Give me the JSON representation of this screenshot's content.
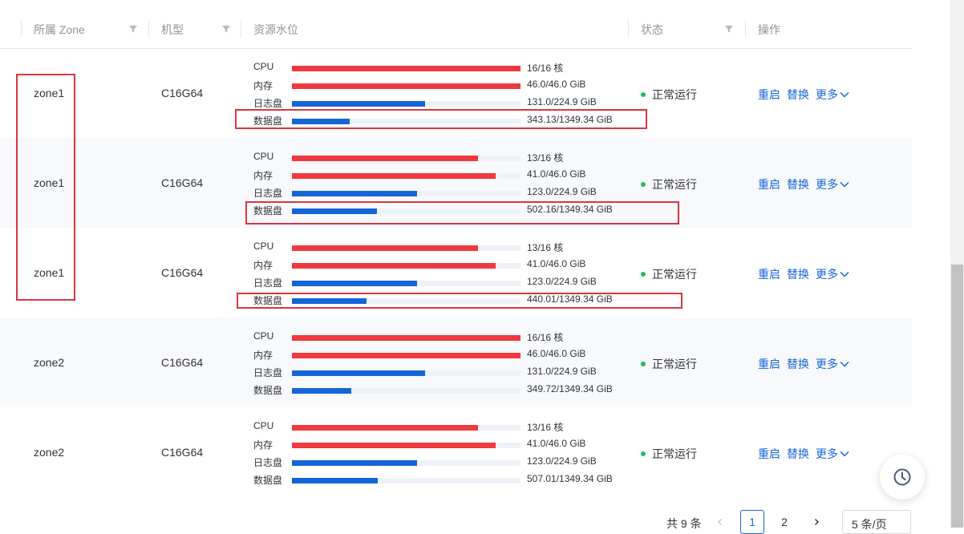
{
  "columns": {
    "zone": "所属 Zone",
    "model": "机型",
    "resource": "资源水位",
    "status": "状态",
    "actions": "操作"
  },
  "colors": {
    "cpu_mem_bar": "#f0393f",
    "disk_bar": "#1565d8",
    "bar_track": "#eef2f8",
    "highlight_box": "#d9363e",
    "link": "#1565d8",
    "status_dot": "#22b868"
  },
  "rows": [
    {
      "zone": "zone1",
      "model": "C16G64",
      "status": "正常运行",
      "resources": [
        {
          "label": "CPU",
          "value": "16/16 核",
          "fill": 1.0
        },
        {
          "label": "内存",
          "value": "46.0/46.0 GiB",
          "fill": 1.0
        },
        {
          "label": "日志盘",
          "value": "131.0/224.9 GiB",
          "fill": 0.582
        },
        {
          "label": "数据盘",
          "value": "343.13/1349.34 GiB",
          "fill": 0.254
        }
      ]
    },
    {
      "zone": "zone1",
      "model": "C16G64",
      "status": "正常运行",
      "resources": [
        {
          "label": "CPU",
          "value": "13/16 核",
          "fill": 0.8125
        },
        {
          "label": "内存",
          "value": "41.0/46.0 GiB",
          "fill": 0.891
        },
        {
          "label": "日志盘",
          "value": "123.0/224.9 GiB",
          "fill": 0.547
        },
        {
          "label": "数据盘",
          "value": "502.16/1349.34 GiB",
          "fill": 0.372
        }
      ]
    },
    {
      "zone": "zone1",
      "model": "C16G64",
      "status": "正常运行",
      "resources": [
        {
          "label": "CPU",
          "value": "13/16 核",
          "fill": 0.8125
        },
        {
          "label": "内存",
          "value": "41.0/46.0 GiB",
          "fill": 0.891
        },
        {
          "label": "日志盘",
          "value": "123.0/224.9 GiB",
          "fill": 0.547
        },
        {
          "label": "数据盘",
          "value": "440.01/1349.34 GiB",
          "fill": 0.326
        }
      ]
    },
    {
      "zone": "zone2",
      "model": "C16G64",
      "status": "正常运行",
      "resources": [
        {
          "label": "CPU",
          "value": "16/16 核",
          "fill": 1.0
        },
        {
          "label": "内存",
          "value": "46.0/46.0 GiB",
          "fill": 1.0
        },
        {
          "label": "日志盘",
          "value": "131.0/224.9 GiB",
          "fill": 0.582
        },
        {
          "label": "数据盘",
          "value": "349.72/1349.34 GiB",
          "fill": 0.259
        }
      ]
    },
    {
      "zone": "zone2",
      "model": "C16G64",
      "status": "正常运行",
      "resources": [
        {
          "label": "CPU",
          "value": "13/16 核",
          "fill": 0.8125
        },
        {
          "label": "内存",
          "value": "41.0/46.0 GiB",
          "fill": 0.891
        },
        {
          "label": "日志盘",
          "value": "123.0/224.9 GiB",
          "fill": 0.547
        },
        {
          "label": "数据盘",
          "value": "507.01/1349.34 GiB",
          "fill": 0.376
        }
      ]
    }
  ],
  "actions": {
    "restart": "重启",
    "replace": "替换",
    "more": "更多"
  },
  "pagination": {
    "total": "共 9 条",
    "pages": [
      "1",
      "2"
    ],
    "current": "1",
    "page_size": "5 条/页"
  },
  "icons": {
    "filter": "filter-icon",
    "chevron": "chevron-down-icon",
    "history": "clock-icon",
    "prev": "chevron-left-icon",
    "next": "chevron-right-icon"
  }
}
